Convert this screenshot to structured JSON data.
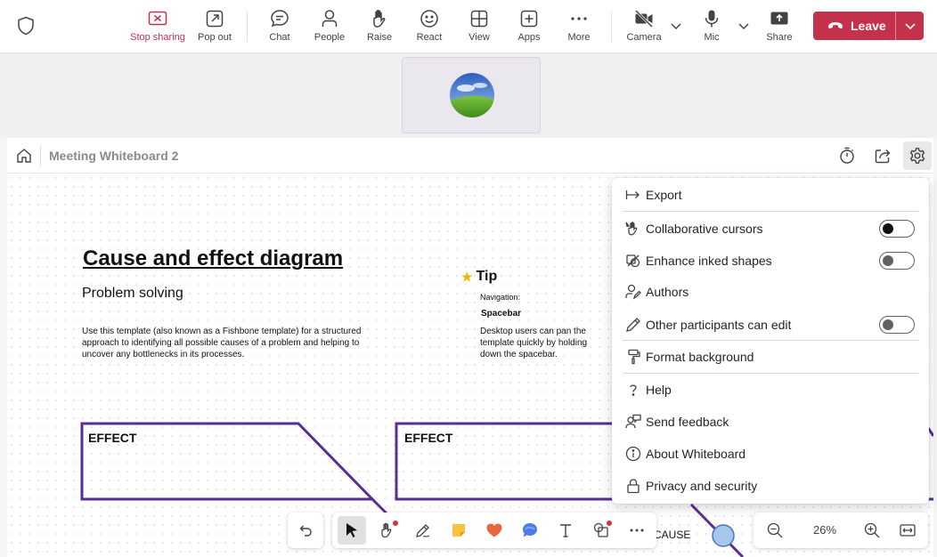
{
  "toolbar": {
    "stop_sharing": "Stop sharing",
    "pop_out": "Pop out",
    "chat": "Chat",
    "people": "People",
    "raise": "Raise",
    "react": "React",
    "view": "View",
    "apps": "Apps",
    "more": "More",
    "camera": "Camera",
    "mic": "Mic",
    "share": "Share",
    "leave": "Leave"
  },
  "whiteboard": {
    "title": "Meeting Whiteboard 2"
  },
  "canvas": {
    "diagram_title": "Cause and effect diagram",
    "diagram_subtitle": "Problem solving",
    "diagram_description": "Use this template (also known as a Fishbone template) for a structured approach to identifying all possible causes of a problem and helping to uncover any bottlenecks in its processes.",
    "tip_title": "Tip",
    "tip_nav_label": "Navigation:",
    "tip_spacebar": "Spacebar",
    "tip_description": "Desktop users can pan the template quickly by holding down the spacebar.",
    "effect_1": "EFFECT",
    "effect_2": "EFFECT",
    "cause": "CAUSE"
  },
  "settings_menu": {
    "export": "Export",
    "collab_cursors": "Collaborative cursors",
    "enhance_shapes": "Enhance inked shapes",
    "authors": "Authors",
    "others_edit": "Other participants can edit",
    "format_bg": "Format background",
    "help": "Help",
    "send_feedback": "Send feedback",
    "about": "About Whiteboard",
    "privacy": "Privacy and security"
  },
  "zoom": {
    "value": "26%"
  },
  "colors": {
    "leave_red": "#c4314b",
    "stop_red": "#c4314b",
    "diagram_purple": "#5c2d91"
  }
}
